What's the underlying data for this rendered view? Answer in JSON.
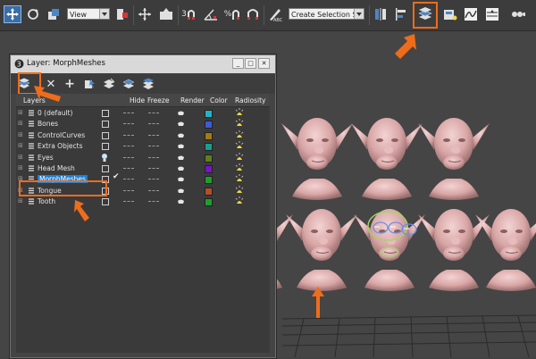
{
  "toolbar": {
    "view_select": "View",
    "selection_set_select": "Create Selection Se",
    "snap_label": "3",
    "angle_snap_label": "n",
    "percent_snap_label": "%",
    "spinner_snap_label": "n"
  },
  "dialog": {
    "title": "Layer: MorphMeshes",
    "columns": {
      "layers": "Layers",
      "hide": "Hide",
      "freeze": "Freeze",
      "render": "Render",
      "color": "Color",
      "radiosity": "Radiosity"
    },
    "layers": [
      {
        "name": "0 (default)",
        "color": "#20b3c8",
        "selected": false,
        "hide_icon": false
      },
      {
        "name": "Bones",
        "color": "#3d5bd6",
        "selected": false,
        "hide_icon": false
      },
      {
        "name": "ControlCurves",
        "color": "#a37b10",
        "selected": false,
        "hide_icon": false
      },
      {
        "name": "Extra Objects",
        "color": "#16a08d",
        "selected": false,
        "hide_icon": false
      },
      {
        "name": "Eyes",
        "color": "#5d7f1c",
        "selected": false,
        "hide_icon": true
      },
      {
        "name": "Head Mesh",
        "color": "#7614c6",
        "selected": false,
        "hide_icon": false
      },
      {
        "name": "MorphMeshes",
        "color": "#1aa02a",
        "selected": true,
        "hide_icon": false
      },
      {
        "name": "Tongue",
        "color": "#b0502a",
        "selected": false,
        "hide_icon": false
      },
      {
        "name": "Tooth",
        "color": "#1aa030",
        "selected": false,
        "hide_icon": false
      }
    ]
  },
  "colors": {
    "highlight": "#ef6c1a",
    "selection": "#1c7fd6",
    "skin": "#e3b2b2"
  }
}
